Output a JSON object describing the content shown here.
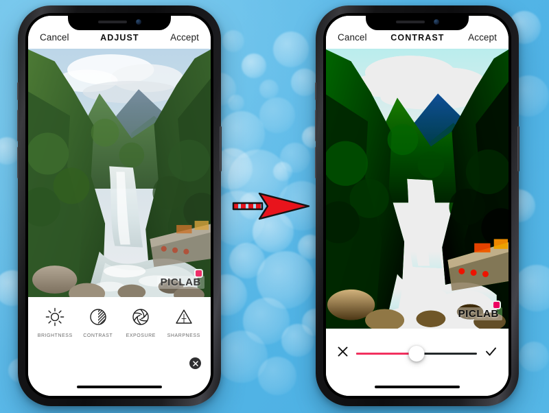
{
  "background": {
    "color": "#59b8e8",
    "style": "blue-bokeh-gradient"
  },
  "arrow": {
    "name": "right-arrow",
    "color": "#e8141c",
    "outline": "#111111",
    "direction": "right"
  },
  "phone_left": {
    "name": "before-phone",
    "appbar": {
      "cancel_label": "Cancel",
      "title": "ADJUST",
      "accept_label": "Accept"
    },
    "photo": {
      "alt": "Waterfall in green mountain valley with rocky river",
      "watermark": "PICLAB"
    },
    "tools": [
      {
        "icon": "brightness-icon",
        "label": "BRIGHTNESS"
      },
      {
        "icon": "contrast-icon",
        "label": "CONTRAST"
      },
      {
        "icon": "exposure-icon",
        "label": "EXPOSURE"
      },
      {
        "icon": "sharpness-icon",
        "label": "SHARPNESS"
      }
    ],
    "close_button": {
      "icon": "close-icon",
      "label": "✕"
    }
  },
  "phone_right": {
    "name": "after-phone",
    "appbar": {
      "cancel_label": "Cancel",
      "title": "CONTRAST",
      "accept_label": "Accept"
    },
    "photo": {
      "alt": "Same waterfall scene with increased contrast",
      "watermark": "PICLAB"
    },
    "slider": {
      "cancel_icon": "close-icon",
      "confirm_icon": "check-icon",
      "value_percent": 50,
      "fill_color": "#f2305e",
      "track_color": "#23282a"
    }
  }
}
